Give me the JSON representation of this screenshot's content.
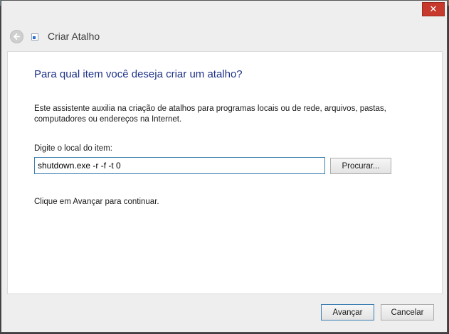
{
  "window": {
    "title": "Criar Atalho",
    "close_glyph": "✕"
  },
  "icons": {
    "back": "back-arrow-icon",
    "app": "shortcut-app-icon",
    "close": "close-icon"
  },
  "page": {
    "heading": "Para qual item você deseja criar um atalho?",
    "description": "Este assistente auxilia na criação de atalhos para programas locais ou de rede, arquivos, pastas, computadores ou endereços na Internet.",
    "field_label": "Digite o local do item:",
    "location_value": "shutdown.exe -r -f -t 0",
    "browse_label": "Procurar...",
    "continue_hint": "Clique em Avançar para continuar."
  },
  "footer": {
    "next_label": "Avançar",
    "cancel_label": "Cancelar"
  },
  "colors": {
    "heading": "#1e3287",
    "close_button": "#c7392c",
    "focus_border": "#3c7fb1"
  }
}
